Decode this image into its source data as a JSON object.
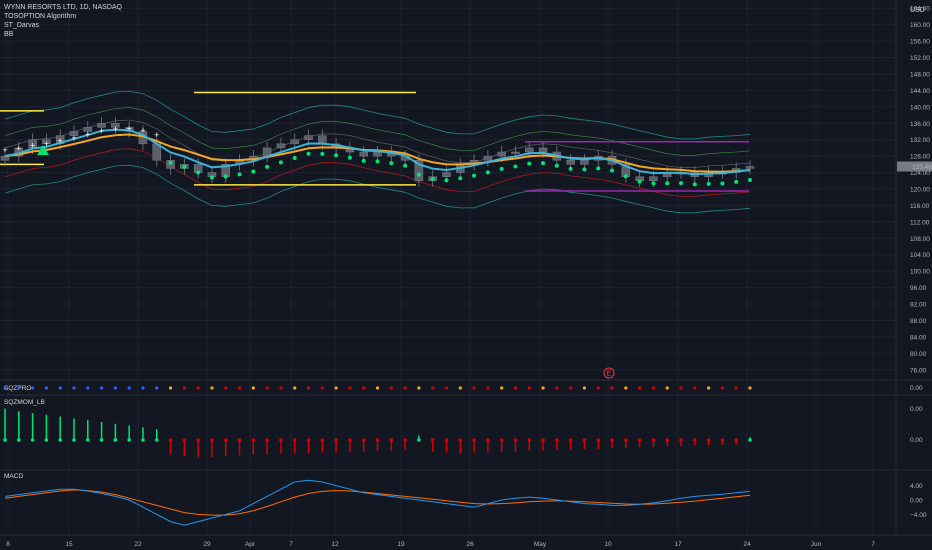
{
  "header": {
    "symbol": "WYNN RESORTS LTD, 1D, NASDAQ",
    "indicators": [
      "TOSOPTION Algorithm",
      "ST_Darvas",
      "BB"
    ],
    "currency": "USD"
  },
  "earnings_marker": "E",
  "price_axis": {
    "ticks": [
      "164.00",
      "160.00",
      "156.00",
      "152.00",
      "148.00",
      "144.00",
      "140.00",
      "136.00",
      "132.00",
      "128.00",
      "124.00",
      "120.00",
      "116.00",
      "112.00",
      "108.00",
      "104.00",
      "100.00",
      "96.00",
      "92.00",
      "88.00",
      "84.00",
      "80.00",
      "76.00"
    ],
    "last_price": "125.48"
  },
  "x_axis": {
    "ticks": [
      "8",
      "15",
      "22",
      "29",
      "Apr",
      "7",
      "12",
      "19",
      "26",
      "May",
      "10",
      "17",
      "24",
      "Jun",
      "7"
    ]
  },
  "panes": {
    "sqzpro": {
      "label": "SQZPRO",
      "ticks": [
        "0.00"
      ]
    },
    "sqzmom": {
      "label": "SQZMOM_LB",
      "ticks": [
        "0.00",
        "0.00"
      ]
    },
    "macd": {
      "label": "MACD",
      "ticks": [
        "4.00",
        "0.00",
        "−4.00"
      ]
    }
  },
  "colors": {
    "bg": "#131722",
    "grid": "#1e2230",
    "candle": "#5d606b",
    "ema_fast": "#3bb4d8",
    "ema_slow": "#f5a623",
    "bb": "#26a69a",
    "darvas": "#ffeb3b",
    "darvas2": "#9c27b0",
    "bull": "#00e676",
    "bear": "#d50000",
    "macd": "#2196f3",
    "signal": "#ff6d00"
  },
  "chart_data": {
    "type": "candlestick",
    "title": "WYNN RESORTS LTD, 1D, NASDAQ",
    "x": [
      "Mar 8",
      "Mar 9",
      "Mar 10",
      "Mar 11",
      "Mar 12",
      "Mar 15",
      "Mar 16",
      "Mar 17",
      "Mar 18",
      "Mar 19",
      "Mar 22",
      "Mar 23",
      "Mar 24",
      "Mar 25",
      "Mar 26",
      "Mar 29",
      "Mar 30",
      "Mar 31",
      "Apr 1",
      "Apr 5",
      "Apr 6",
      "Apr 7",
      "Apr 8",
      "Apr 9",
      "Apr 12",
      "Apr 13",
      "Apr 14",
      "Apr 15",
      "Apr 16",
      "Apr 19",
      "Apr 20",
      "Apr 21",
      "Apr 22",
      "Apr 23",
      "Apr 26",
      "Apr 27",
      "Apr 28",
      "Apr 29",
      "Apr 30",
      "May 3",
      "May 4",
      "May 5",
      "May 6",
      "May 7",
      "May 10",
      "May 11",
      "May 12",
      "May 13",
      "May 14",
      "May 17",
      "May 18",
      "May 19",
      "May 20",
      "May 21",
      "May 24"
    ],
    "close": [
      128,
      130,
      132,
      131,
      133,
      134,
      135,
      136,
      135,
      134,
      131,
      127,
      125,
      126,
      124,
      123,
      126,
      127,
      128,
      130,
      131,
      132,
      133,
      131,
      130,
      129,
      128,
      129,
      128,
      127,
      122,
      123,
      124,
      126,
      127,
      128,
      129,
      129,
      130,
      129,
      127,
      126,
      127,
      128,
      126,
      123,
      122,
      123,
      124,
      124,
      123,
      124,
      124,
      125,
      125.48
    ],
    "price_range": [
      74,
      166
    ],
    "series": [
      {
        "name": "SQZMOM_LB",
        "values": [
          3.5,
          3.2,
          3.0,
          2.8,
          2.6,
          2.4,
          2.2,
          2.0,
          1.8,
          1.6,
          1.4,
          1.2,
          -1.6,
          -1.8,
          -2.0,
          -1.9,
          -1.8,
          -1.7,
          -1.6,
          -1.6,
          -1.5,
          -1.5,
          -1.5,
          -1.4,
          -1.4,
          -1.3,
          -1.3,
          -1.2,
          -1.2,
          -1.1,
          0.5,
          -1.3,
          -1.4,
          -1.5,
          -1.4,
          -1.4,
          -1.3,
          -1.3,
          -1.2,
          -1.2,
          -1.1,
          -1.1,
          -1.0,
          -1.0,
          -0.9,
          -0.9,
          -0.8,
          -0.8,
          -0.7,
          -0.7,
          -0.6,
          -0.6,
          -0.5,
          -0.5,
          0.3
        ]
      },
      {
        "name": "MACD",
        "values": [
          1.0,
          1.5,
          2.0,
          2.5,
          3.0,
          3.0,
          2.5,
          1.8,
          1.0,
          0,
          -2,
          -4,
          -6,
          -7,
          -6,
          -5,
          -4,
          -3,
          -1,
          1,
          3,
          5,
          5.5,
          5,
          4,
          3,
          2,
          1.5,
          1,
          0.5,
          0,
          -0.5,
          -1,
          -1.5,
          -2,
          -1,
          0,
          0.5,
          0.8,
          0.5,
          0,
          -0.5,
          -1,
          -1.2,
          -1.5,
          -1.5,
          -1.2,
          -0.8,
          -0.2,
          0.5,
          1.0,
          1.3,
          1.6,
          2.0,
          2.4
        ]
      },
      {
        "name": "Signal",
        "values": [
          0.5,
          1.0,
          1.5,
          2.0,
          2.5,
          2.8,
          2.6,
          2.2,
          1.5,
          0.5,
          -0.5,
          -1.5,
          -2.5,
          -3.5,
          -4,
          -4.2,
          -4.2,
          -3.8,
          -3,
          -1.8,
          -0.5,
          0.8,
          1.8,
          2.4,
          2.6,
          2.5,
          2.2,
          1.8,
          1.4,
          1.0,
          0.6,
          0.2,
          -0.2,
          -0.6,
          -1.0,
          -1.1,
          -1.0,
          -0.8,
          -0.5,
          -0.3,
          -0.2,
          -0.3,
          -0.5,
          -0.7,
          -0.9,
          -1.1,
          -1.2,
          -1.1,
          -0.9,
          -0.6,
          -0.3,
          0.1,
          0.5,
          0.9,
          1.3
        ]
      }
    ]
  }
}
